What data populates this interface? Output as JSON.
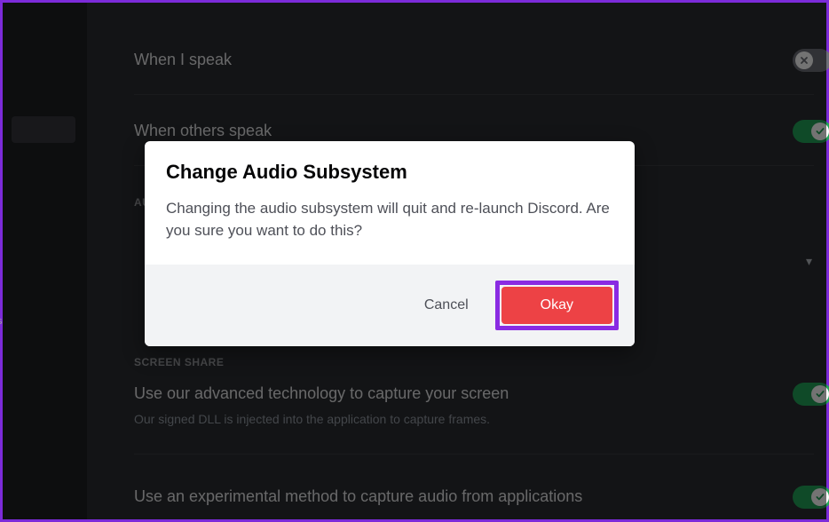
{
  "settings": {
    "row1": {
      "title": "When I speak"
    },
    "row2": {
      "title": "When others speak"
    },
    "section_audio_label": "AUDIO SUBSYSTEM",
    "section_screen_label": "SCREEN SHARE",
    "row3": {
      "title": "Use our advanced technology to capture your screen",
      "subtext": "Our signed DLL is injected into the application to capture frames."
    },
    "row4": {
      "title": "Use an experimental method to capture audio from applications"
    }
  },
  "sidebar": {
    "partial_label": "s"
  },
  "modal": {
    "title": "Change Audio Subsystem",
    "text": "Changing the audio subsystem will quit and re-launch Discord. Are you sure you want to do this?",
    "cancel": "Cancel",
    "okay": "Okay"
  },
  "dropdown_chevron": "▾"
}
